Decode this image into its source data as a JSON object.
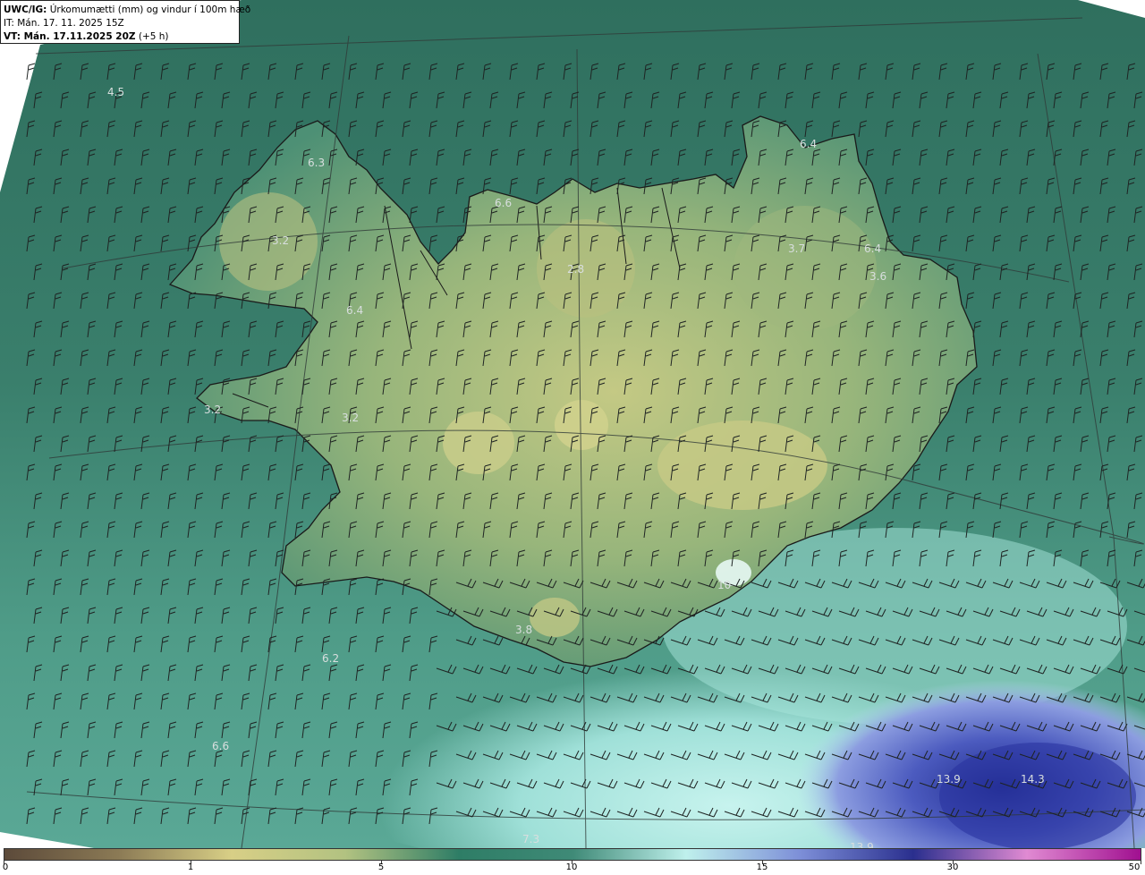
{
  "header": {
    "product": "UWC/IG:",
    "title": " Úrkomumætti (mm) og vindur í 100m hæð",
    "init_time": "IT: Mán. 17. 11. 2025 15Z",
    "valid_time": "VT: Mán. 17.11.2025 20Z",
    "lead": " (+5 h)"
  },
  "map": {
    "region": "Iceland",
    "field_labels": [
      "4.5",
      "6.3",
      "3.2",
      "6.6",
      "6.4",
      "3.7",
      "6.4",
      "3.6",
      "2.8",
      "6.4",
      "3.2",
      "3.2",
      "10",
      "3.8",
      "6.2",
      "6.6",
      "13.9",
      "14.3",
      "7.3",
      "13.9"
    ]
  },
  "colorbar": {
    "ticks": [
      "0",
      "1",
      "5",
      "10",
      "15",
      "30",
      "50"
    ],
    "colors": [
      "#5c4a3a",
      "#8b7a55",
      "#d8cf86",
      "#b2c281",
      "#2e7d66",
      "#3f8a77",
      "#bff0ec",
      "#7d8fd8",
      "#2a2f8e",
      "#e08ad2",
      "#a01090"
    ]
  },
  "icons": [
    "wind-barb-icon"
  ]
}
